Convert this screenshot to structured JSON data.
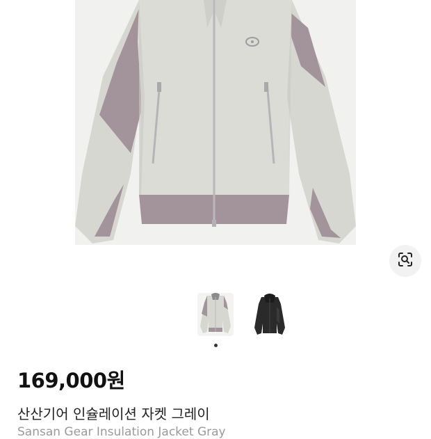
{
  "product": {
    "price": "169,000원",
    "name_ko": "산산기어 인슐레이션 자켓 그레이",
    "name_en": "Sansan Gear Insulation Jacket Gray"
  },
  "gallery": {
    "thumbnails": [
      {
        "name": "thumbnail-gray-jacket",
        "color": "gray"
      },
      {
        "name": "thumbnail-black-jacket",
        "color": "black"
      }
    ],
    "selected_index": 0
  },
  "icons": {
    "lens": "lens-search-icon"
  },
  "colors": {
    "jacket_body": "#d9d9d4",
    "jacket_panel": "#a3939a",
    "background": "#f1f1ef"
  }
}
